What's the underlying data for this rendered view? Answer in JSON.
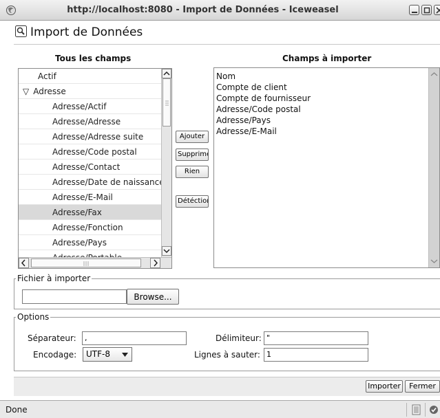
{
  "window": {
    "title": "http://localhost:8080 - Import de Données - Iceweasel"
  },
  "dialog": {
    "title": "Import de Données"
  },
  "left_panel": {
    "header": "Tous les champs",
    "items": [
      {
        "label": "Actif",
        "indent": 0,
        "expander": ""
      },
      {
        "label": "Adresse",
        "indent": 0,
        "expander": "▽"
      },
      {
        "label": "Adresse/Actif",
        "indent": 2,
        "expander": ""
      },
      {
        "label": "Adresse/Adresse",
        "indent": 2,
        "expander": ""
      },
      {
        "label": "Adresse/Adresse suite",
        "indent": 2,
        "expander": ""
      },
      {
        "label": "Adresse/Code postal",
        "indent": 2,
        "expander": ""
      },
      {
        "label": "Adresse/Contact",
        "indent": 2,
        "expander": ""
      },
      {
        "label": "Adresse/Date de naissance",
        "indent": 2,
        "expander": ""
      },
      {
        "label": "Adresse/E-Mail",
        "indent": 2,
        "expander": ""
      },
      {
        "label": "Adresse/Fax",
        "indent": 2,
        "expander": "",
        "selected": true
      },
      {
        "label": "Adresse/Fonction",
        "indent": 2,
        "expander": ""
      },
      {
        "label": "Adresse/Pays",
        "indent": 2,
        "expander": ""
      },
      {
        "label": "Adresse/Portable",
        "indent": 2,
        "expander": ""
      }
    ]
  },
  "actions": {
    "add": "Ajouter",
    "remove": "Supprimer",
    "none": "Rien",
    "detect": "Détéction"
  },
  "right_panel": {
    "header": "Champs à importer",
    "items": [
      "Nom",
      "Compte de client",
      "Compte de fournisseur",
      "Adresse/Code postal",
      "Adresse/Pays",
      "Adresse/E-Mail"
    ]
  },
  "file_group": {
    "legend": "Fichier à importer",
    "value": "",
    "browse": "Browse..."
  },
  "options": {
    "legend": "Options",
    "separator_label": "Séparateur:",
    "separator_value": ",",
    "delimiter_label": "Délimiteur:",
    "delimiter_value": "\"",
    "encoding_label": "Encodage:",
    "encoding_value": "UTF-8",
    "skip_label": "Lignes à sauter:",
    "skip_value": "1"
  },
  "footer": {
    "import": "Importer",
    "close": "Fermer"
  },
  "status": {
    "text": "Done"
  }
}
